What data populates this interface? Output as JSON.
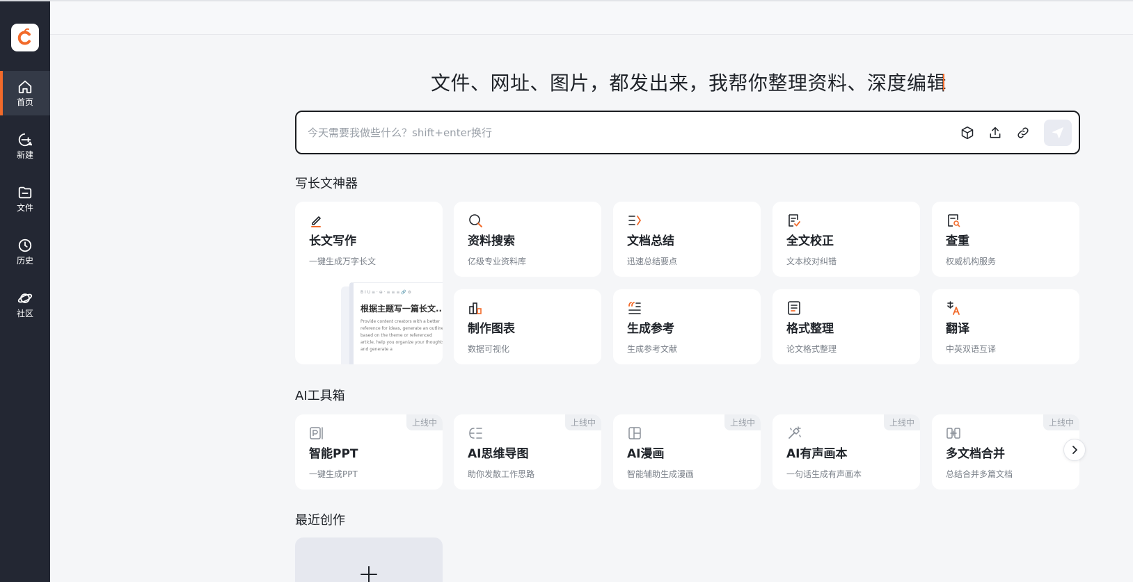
{
  "colors": {
    "accent": "#f26a2a",
    "sidebar": "#232733",
    "text": "#1f2329",
    "muted": "#7a8089"
  },
  "sidebar": {
    "logo": "app-logo",
    "items": [
      {
        "label": "首页",
        "icon": "home-icon",
        "active": true
      },
      {
        "label": "新建",
        "icon": "new-chat-icon"
      },
      {
        "label": "文件",
        "icon": "folder-icon"
      },
      {
        "label": "历史",
        "icon": "clock-icon"
      },
      {
        "label": "社区",
        "icon": "planet-icon"
      }
    ]
  },
  "headline": "文件、网址、图片，都发出来，我帮你整理资料、深度编辑",
  "search": {
    "placeholder": "今天需要我做些什么？shift+enter换行",
    "tools": [
      "cube-icon",
      "upload-icon",
      "link-icon"
    ],
    "send": "send-icon"
  },
  "sections": {
    "writing": "写长文神器",
    "toolbox": "AI工具箱",
    "recent": "最近创作"
  },
  "writing_cards": [
    {
      "title": "长文写作",
      "subtitle": "一键生成万字长文",
      "icon": "pen-icon"
    },
    {
      "title": "资料搜索",
      "subtitle": "亿级专业资料库",
      "icon": "search-icon"
    },
    {
      "title": "文档总结",
      "subtitle": "迅速总结要点",
      "icon": "summary-icon"
    },
    {
      "title": "全文校正",
      "subtitle": "文本校对纠错",
      "icon": "proofread-icon"
    },
    {
      "title": "查重",
      "subtitle": "权威机构服务",
      "icon": "duplicate-check-icon"
    },
    {
      "title": "制作图表",
      "subtitle": "数据可视化",
      "icon": "chart-icon"
    },
    {
      "title": "生成参考",
      "subtitle": "生成参考文献",
      "icon": "quote-icon"
    },
    {
      "title": "格式整理",
      "subtitle": "论文格式整理",
      "icon": "format-icon"
    },
    {
      "title": "翻译",
      "subtitle": "中英双语互译",
      "icon": "translate-icon"
    }
  ],
  "preview": {
    "toolbar": "B I U ≡ · ⊕ · ≡ ≡ ≡ 🔗 ⚙",
    "title": "根据主题写一篇长文...",
    "body": "Provide content creators with a better reference for ideas, generate an outline based on the theme or referenced article, help you organize your thoughts and generate a"
  },
  "toolbox_cards": [
    {
      "title": "智能PPT",
      "subtitle": "一键生成PPT",
      "badge": "上线中",
      "icon": "ppt-icon"
    },
    {
      "title": "AI思维导图",
      "subtitle": "助你发散工作思路",
      "badge": "上线中",
      "icon": "mindmap-icon"
    },
    {
      "title": "AI漫画",
      "subtitle": "智能辅助生成漫画",
      "badge": "上线中",
      "icon": "comic-icon"
    },
    {
      "title": "AI有声画本",
      "subtitle": "一句话生成有声画本",
      "badge": "上线中",
      "icon": "audio-book-icon"
    },
    {
      "title": "多文档合并",
      "subtitle": "总结合并多篇文档",
      "badge": "上线中",
      "icon": "merge-icon"
    }
  ]
}
